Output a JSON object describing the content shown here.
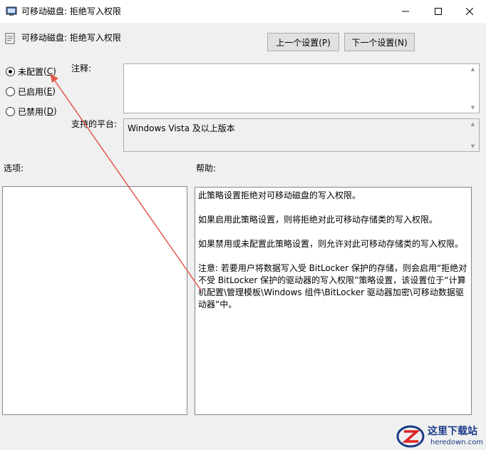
{
  "window": {
    "title": "可移动磁盘: 拒绝写入权限",
    "controls": [
      "minimize-icon",
      "maximize-icon",
      "close-icon"
    ]
  },
  "header": {
    "setting_name": "可移动磁盘: 拒绝写入权限",
    "prev_button": "上一个设置(P)",
    "next_button": "下一个设置(N)"
  },
  "state_options": [
    {
      "label": "未配置",
      "accel": "C",
      "selected": true
    },
    {
      "label": "已启用",
      "accel": "E",
      "selected": false
    },
    {
      "label": "已禁用",
      "accel": "D",
      "selected": false
    }
  ],
  "comment": {
    "label": "注释:",
    "value": ""
  },
  "platform": {
    "label": "支持的平台:",
    "value": "Windows Vista 及以上版本"
  },
  "options": {
    "label": "选项:"
  },
  "help": {
    "label": "帮助:",
    "paragraphs": [
      "此策略设置拒绝对可移动磁盘的写入权限。",
      "如果启用此策略设置，则将拒绝对此可移动存储类的写入权限。",
      "如果禁用或未配置此策略设置，则允许对此可移动存储类的写入权限。",
      "注意: 若要用户将数据写入受 BitLocker 保护的存储，则会启用“拒绝对不受 BitLocker 保护的驱动器的写入权限”策略设置，该设置位于“计算机配置\\管理模板\\Windows 组件\\BitLocker 驱动器加密\\可移动数据驱动器”中。"
    ]
  },
  "watermark": {
    "title": "这里下载站",
    "url": "heredown.com"
  },
  "colors": {
    "annotation_arrow": "#e05a4e",
    "watermark": "#1a3b88"
  }
}
